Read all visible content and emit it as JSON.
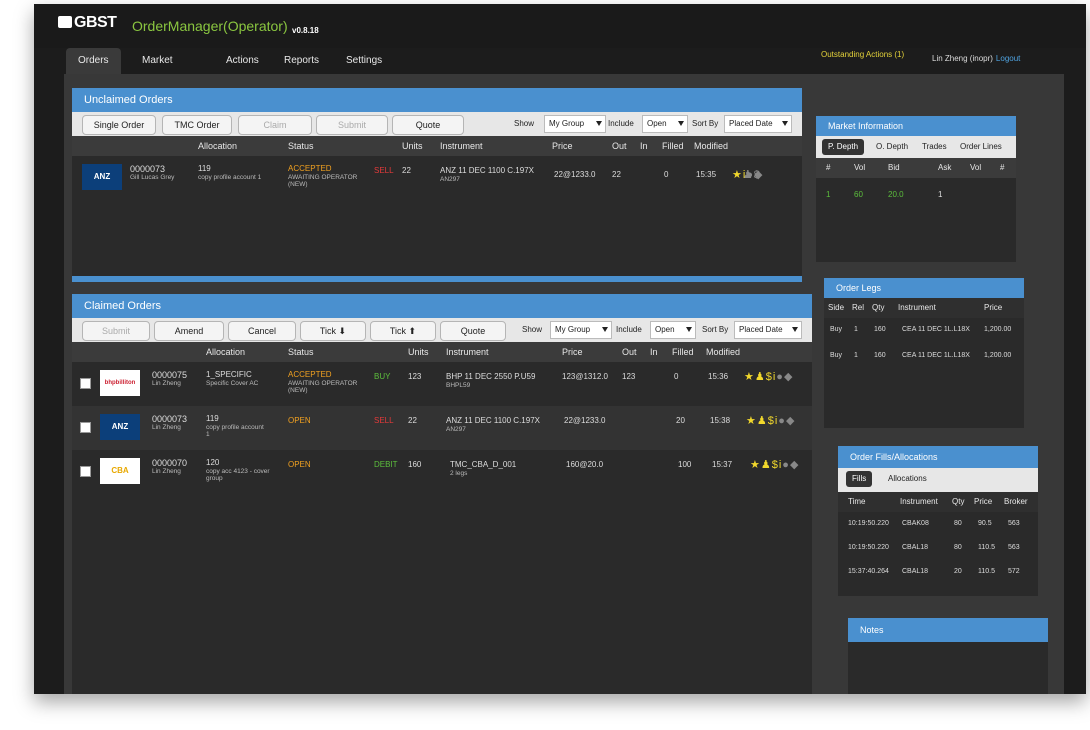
{
  "header": {
    "logo": "GBST",
    "title": "OrderManager(Operator)",
    "version": "v0.8.18",
    "outstanding": "Outstanding Actions (1)",
    "user": "Lin Zheng (inopr)",
    "logout": "Logout"
  },
  "tabs": [
    "Orders",
    "Market Data",
    "Actions",
    "Reports",
    "Settings"
  ],
  "unclaimed": {
    "title": "Unclaimed Orders",
    "buttons": [
      "Single Order",
      "TMC Order",
      "Claim",
      "Submit",
      "Quote"
    ],
    "show_label": "Show",
    "show_value": "My Group",
    "include_label": "Include",
    "include_value": "Open",
    "sort_label": "Sort By",
    "sort_value": "Placed Date",
    "columns": [
      "Allocation",
      "Status",
      "Units",
      "Instrument",
      "Price",
      "Out",
      "In",
      "Filled",
      "Modified"
    ],
    "rows": [
      {
        "logo": "ANZ",
        "id": "0000073",
        "name": "Gill Lucas Grey",
        "alloc": "119",
        "alloc_sub": "copy profile account 1",
        "status": "ACCEPTED",
        "status_sub": "AWAITING OPERATOR (NEW)",
        "side": "SELL",
        "units": "22",
        "instrument": "ANZ 11 DEC 1100 C.197X",
        "inst_sub": "AN297",
        "price": "22@1233.0",
        "out": "22",
        "in": "",
        "filled": "0",
        "modified": "15:35"
      }
    ]
  },
  "claimed": {
    "title": "Claimed Orders",
    "buttons": [
      "Submit",
      "Amend",
      "Cancel",
      "Tick ⬇",
      "Tick ⬆",
      "Quote"
    ],
    "show_label": "Show",
    "show_value": "My Group",
    "include_label": "Include",
    "include_value": "Open",
    "sort_label": "Sort By",
    "sort_value": "Placed Date",
    "columns": [
      "Allocation",
      "Status",
      "Units",
      "Instrument",
      "Price",
      "Out",
      "In",
      "Filled",
      "Modified"
    ],
    "rows": [
      {
        "logo": "bhpbilliton",
        "id": "0000075",
        "name": "Lin Zheng",
        "alloc": "1_SPECIFIC",
        "alloc_sub": "Specific Cover AC",
        "status": "ACCEPTED",
        "status_sub": "AWAITING OPERATOR (NEW)",
        "side": "BUY",
        "units": "123",
        "instrument": "BHP 11 DEC 2550 P.U59",
        "inst_sub": "BHPL59",
        "price": "123@1312.0",
        "out": "123",
        "in": "",
        "filled": "0",
        "modified": "15:36"
      },
      {
        "logo": "ANZ",
        "id": "0000073",
        "name": "Lin Zheng",
        "alloc": "119",
        "alloc_sub": "copy profile account 1",
        "status": "OPEN",
        "status_sub": "",
        "side": "SELL",
        "units": "22",
        "instrument": "ANZ 11 DEC 1100 C.197X",
        "inst_sub": "AN297",
        "price": "22@1233.0",
        "out": "",
        "in": "",
        "filled": "20",
        "modified": "15:38"
      },
      {
        "logo": "CBA",
        "id": "0000070",
        "name": "Lin Zheng",
        "alloc": "120",
        "alloc_sub": "copy acc 4123 - cover group",
        "status": "OPEN",
        "status_sub": "",
        "side": "DEBIT",
        "units": "160",
        "instrument": "TMC_CBA_D_001",
        "inst_sub": "2 legs",
        "price": "160@20.0",
        "out": "",
        "in": "",
        "filled": "100",
        "modified": "15:37"
      }
    ]
  },
  "market": {
    "title": "Market Information",
    "tabs": [
      "P. Depth",
      "O. Depth",
      "Trades",
      "Order Lines"
    ],
    "columns": [
      "#",
      "Vol",
      "Bid",
      "Ask",
      "Vol",
      "#"
    ],
    "row": [
      "1",
      "60",
      "20.0",
      "1"
    ]
  },
  "legs": {
    "title": "Order Legs",
    "columns": [
      "Side",
      "Rel",
      "Qty",
      "Instrument",
      "Price"
    ],
    "rows": [
      [
        "Buy",
        "1",
        "160",
        "CEA 11 DEC 1L.L18X",
        "1,200.00"
      ],
      [
        "Buy",
        "1",
        "160",
        "CEA 11 DEC 1L.L18X",
        "1,200.00"
      ]
    ]
  },
  "fills": {
    "title": "Order Fills/Allocations",
    "tabs": [
      "Fills",
      "Allocations"
    ],
    "columns": [
      "Time",
      "Instrument",
      "Qty",
      "Price",
      "Broker"
    ],
    "rows": [
      [
        "10:19:50.220",
        "CBAK08",
        "80",
        "90.5",
        "563"
      ],
      [
        "10:19:50.220",
        "CBAL18",
        "80",
        "110.5",
        "563"
      ],
      [
        "15:37:40.264",
        "CBAL18",
        "20",
        "110.5",
        "572"
      ]
    ]
  },
  "notes": {
    "title": "Notes"
  }
}
